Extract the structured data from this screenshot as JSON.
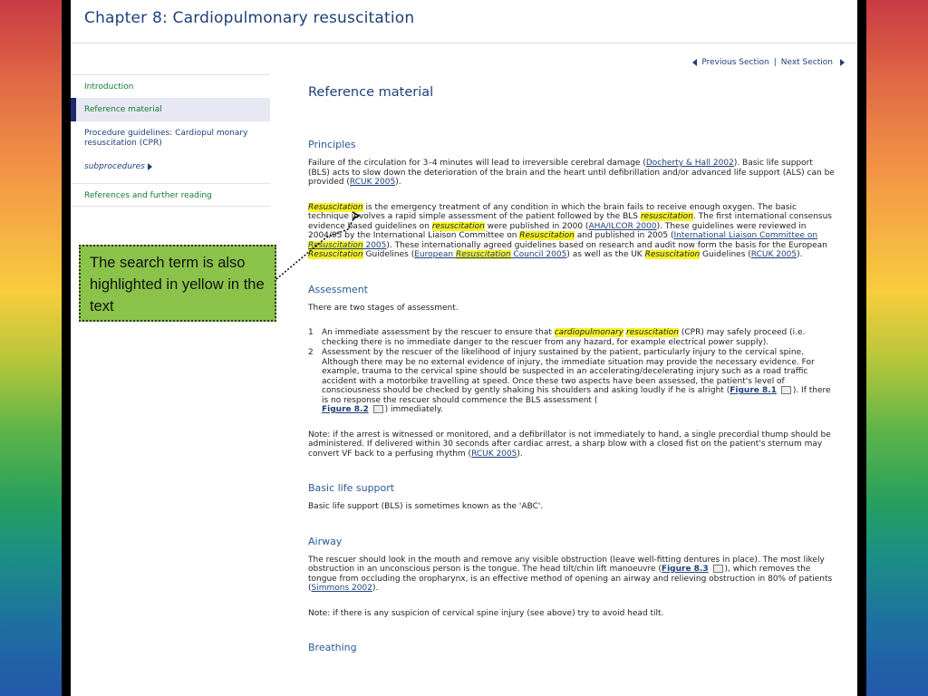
{
  "chapter": {
    "title": "Chapter 8: Cardiopulmonary resuscitation"
  },
  "nav": {
    "previous": "Previous Section",
    "separator": "|",
    "next": "Next Section"
  },
  "sidebar": {
    "items": [
      {
        "label": "Introduction"
      },
      {
        "label": "Reference material"
      },
      {
        "label": "Procedure guidelines: Cardiopul monary resuscitation (CPR)"
      },
      {
        "label": "subprocedures"
      },
      {
        "label": "References and further reading"
      }
    ]
  },
  "main": {
    "title": "Reference material",
    "principles": {
      "heading": "Principles",
      "p1": {
        "a": "Failure of the circulation for 3–4 minutes will lead to irreversible cerebral damage (",
        "link1": "Docherty & Hall 2002",
        "b": "). Basic life support (BLS) acts to slow down the deterioration of the brain and the heart until defibrillation and/or advanced life support (ALS) can be provided (",
        "link2": "RCUK 2005",
        "c": ")."
      },
      "p2": {
        "hl1": "Resuscitation",
        "a": " is the emergency treatment of any condition in which the brain fails to receive enough oxygen. The basic technique involves a rapid simple assessment of the patient followed by the BLS ",
        "hl2": "resuscitation",
        "b": ". The first international consensus evidence based guidelines on ",
        "hl3": "resuscitation",
        "c": " were published in 2000 (",
        "link1": "AHA/ILCOR 2000",
        "d": "). These guidelines were reviewed in 2004/05 by the International Liaison Committee on ",
        "hl4": "Resuscitation",
        "e": " and published in 2005 (",
        "link2a": "International Liaison Committee on ",
        "link2hl": "Resuscitation",
        "link2b": " 2005",
        "f": "). These internationally agreed guidelines based on research and audit now form the basis for the European ",
        "hl5": "Resuscitation",
        "g": " Guidelines (",
        "link3a": "European ",
        "link3hl": "Resuscitation",
        "link3b": " Council 2005",
        "h": ") as well as the UK ",
        "hl6": "Resuscitation",
        "i": " Guidelines (",
        "link4": "RCUK 2005",
        "j": ")."
      }
    },
    "assessment": {
      "heading": "Assessment",
      "intro": "There are two stages of assessment.",
      "item1": {
        "num": "1",
        "a": "An immediate assessment by the rescuer to ensure that ",
        "hl1": "cardiopulmonary",
        "sp": " ",
        "hl2": "resuscitation",
        "b": " (CPR) may safely proceed (i.e. checking there is no immediate danger to the rescuer from any hazard, for example electrical power supply)."
      },
      "item2": {
        "num": "2",
        "a": "Assessment by the rescuer of the likelihood of injury sustained by the patient, particularly injury to the cervical spine. Although there may be no external evidence of injury, the immediate situation may provide the necessary evidence. For example, trauma to the cervical spine should be suspected in an accelerating/decelerating injury such as a road traffic accident with a motorbike travelling at speed. Once these two aspects have been assessed, the patient's level of consciousness should be checked by gently shaking his shoulders and asking loudly if he is alright (",
        "fig1": "Figure 8.1",
        "b": "). If there is no response the rescuer should commence the BLS assessment (",
        "fig2": "Figure 8.2",
        "c": ") immediately."
      },
      "note": {
        "a": "Note: if the arrest is witnessed or monitored, and a defibrillator is not immediately to hand, a single precordial thump should be administered. If delivered within 30 seconds after cardiac arrest, a sharp blow with a closed fist on the patient's sternum may convert VF back to a perfusing rhythm (",
        "link": "RCUK 2005",
        "b": ")."
      }
    },
    "bls": {
      "heading": "Basic life support",
      "text": "Basic life support (BLS) is sometimes known as the 'ABC'."
    },
    "airway": {
      "heading": "Airway",
      "p1": {
        "a": "The rescuer should look in the mouth and remove any visible obstruction (leave well-fitting dentures in place). The most likely obstruction in an unconscious person is the tongue. The head tilt/chin lift manoeuvre (",
        "fig": "Figure 8.3",
        "b": "), which removes the tongue from occluding the oropharynx, is an effective method of opening an airway and relieving obstruction in 80% of patients (",
        "link": "Simmons 2002",
        "c": ")."
      },
      "note": "Note: if there is any suspicion of cervical spine injury (see above) try to avoid head tilt."
    },
    "breathing": {
      "heading": "Breathing"
    }
  },
  "callout": {
    "text": "The search term is also highlighted in yellow in the text"
  },
  "colors": {
    "highlight": "#f7f32a",
    "callout_bg": "#8bc34a",
    "title_blue": "#1f3f7a",
    "sidebar_green": "#157a2e"
  }
}
